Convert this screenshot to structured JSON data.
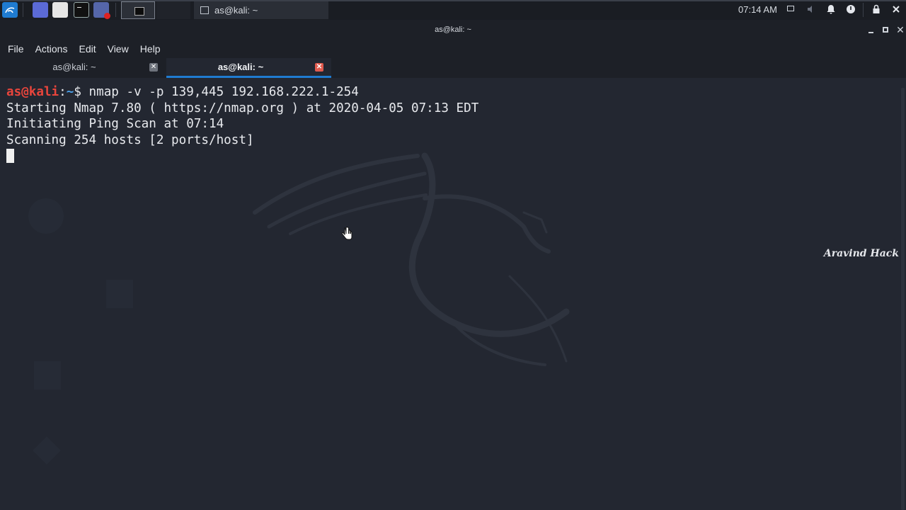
{
  "panel": {
    "launchers": [
      "kali-menu",
      "browser",
      "file-manager",
      "terminal",
      "other-app"
    ],
    "taskbar_item": "as@kali: ~",
    "clock": "07:14 AM"
  },
  "window": {
    "title": "as@kali: ~",
    "menu": [
      "File",
      "Actions",
      "Edit",
      "View",
      "Help"
    ],
    "tabs": [
      {
        "label": "as@kali: ~",
        "active": false
      },
      {
        "label": "as@kali: ~",
        "active": true
      }
    ]
  },
  "terminal": {
    "prompt_user": "as@kali",
    "prompt_sep": ":",
    "prompt_path": "~",
    "prompt_symbol": "$",
    "command": " nmap -v -p 139,445 192.168.222.1-254",
    "output": [
      "Starting Nmap 7.80 ( https://nmap.org ) at 2020-04-05 07:13 EDT",
      "Initiating Ping Scan at 07:14",
      "Scanning 254 hosts [2 ports/host]"
    ]
  },
  "watermark": "Aravind Hack",
  "colors": {
    "background": "#232731",
    "accent": "#1f7bd0",
    "prompt_user": "#e8453c",
    "prompt_path": "#4b9fe8"
  }
}
